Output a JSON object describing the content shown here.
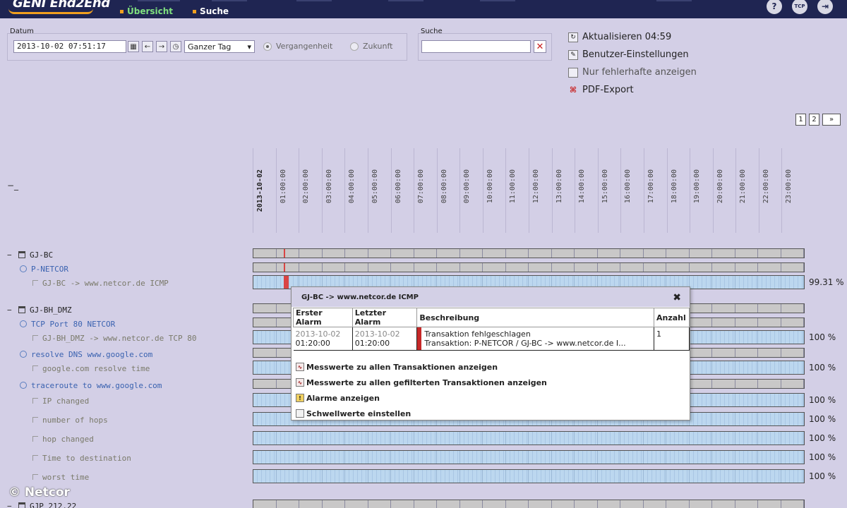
{
  "app": {
    "logo_text": "GENI End2End"
  },
  "nav": {
    "items": [
      {
        "label": "Übersicht",
        "active": true
      },
      {
        "label": "Suche",
        "active": false
      }
    ]
  },
  "top_icons": {
    "help": "?",
    "tcp": "TCP",
    "logout": "⇥"
  },
  "filter": {
    "datum_label": "Datum",
    "datum_value": "2013-10-02 07:51:17",
    "range_value": "Ganzer Tag",
    "radio_past": "Vergangenheit",
    "radio_future": "Zukunft",
    "search_label": "Suche",
    "search_value": "",
    "clear_symbol": "✕"
  },
  "actions": {
    "refresh": "Aktualisieren 04:59",
    "settings": "Benutzer-Einstellungen",
    "only_faulty": "Nur fehlerhafte anzeigen",
    "pdf_export": "PDF-Export"
  },
  "pager": {
    "pages": [
      "1",
      "2"
    ],
    "next": "»"
  },
  "collapse_all": "−_",
  "time_axis": [
    "2013-10-02",
    "01:00:00",
    "02:00:00",
    "03:00:00",
    "04:00:00",
    "05:00:00",
    "06:00:00",
    "07:00:00",
    "08:00:00",
    "09:00:00",
    "10:00:00",
    "11:00:00",
    "12:00:00",
    "13:00:00",
    "14:00:00",
    "15:00:00",
    "16:00:00",
    "17:00:00",
    "18:00:00",
    "19:00:00",
    "20:00:00",
    "21:00:00",
    "22:00:00",
    "23:00:00"
  ],
  "tree": [
    {
      "label": "GJ-BC",
      "kind": "host"
    },
    {
      "label": "P-NETCOR",
      "kind": "trans"
    },
    {
      "label": "GJ-BC -> www.netcor.de ICMP",
      "kind": "leaf",
      "pct": "99.31 %"
    },
    {
      "label": "GJ-BH_DMZ",
      "kind": "host"
    },
    {
      "label": "TCP Port 80 NETCOR",
      "kind": "trans"
    },
    {
      "label": "GJ-BH_DMZ -> www.netcor.de TCP 80",
      "kind": "leaf",
      "pct": "100 %"
    },
    {
      "label": "resolve DNS www.google.com",
      "kind": "trans"
    },
    {
      "label": "google.com resolve time",
      "kind": "leaf",
      "pct": "100 %"
    },
    {
      "label": "traceroute to www.google.com",
      "kind": "trans"
    },
    {
      "label": "IP changed",
      "kind": "leaf",
      "pct": "100 %"
    },
    {
      "label": "number of hops",
      "kind": "leaf",
      "pct": "100 %"
    },
    {
      "label": "hop changed",
      "kind": "leaf",
      "pct": "100 %"
    },
    {
      "label": "Time to destination",
      "kind": "leaf",
      "pct": "100 %"
    },
    {
      "label": "worst time",
      "kind": "leaf",
      "pct": "100 %"
    },
    {
      "label": "GJP 212.22",
      "kind": "host"
    }
  ],
  "popup": {
    "title": "GJ-BC -> www.netcor.de ICMP",
    "close": "✖",
    "headers": [
      "Erster Alarm",
      "Letzter Alarm",
      "Beschreibung",
      "Anzahl"
    ],
    "row": {
      "first_date": "2013-10-02",
      "first_time": "01:20:00",
      "last_date": "2013-10-02",
      "last_time": "01:20:00",
      "desc1": "Transaktion fehlgeschlagen",
      "desc2": "Transaktion: P-NETCOR / GJ-BC -> www.netcor.de I...",
      "count": "1"
    },
    "links": [
      "Messwerte zu allen Transaktionen anzeigen",
      "Messwerte zu allen gefilterten Transaktionen anzeigen",
      "Alarme anzeigen",
      "Schwellwerte einstellen"
    ]
  },
  "copyright": "© Netcor"
}
